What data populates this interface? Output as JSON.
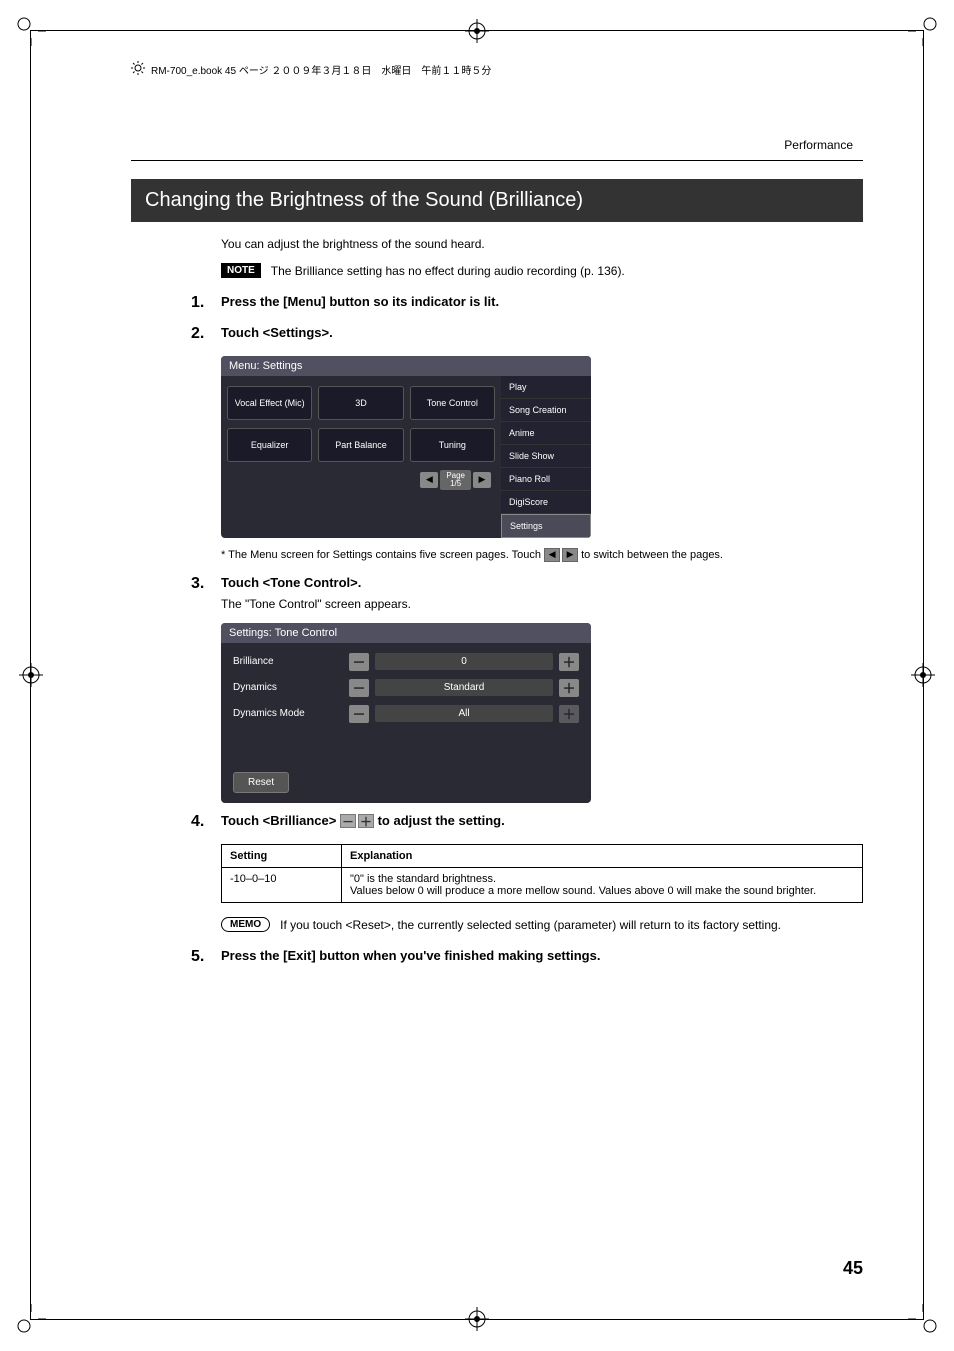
{
  "book_meta": "RM-700_e.book 45 ページ ２００９年３月１８日　水曜日　午前１１時５分",
  "running_head": "Performance",
  "section_title": "Changing the Brightness of the Sound (Brilliance)",
  "intro_text": "You can adjust the brightness of the sound heard.",
  "note_badge": "NOTE",
  "note_text": "The Brilliance setting has no effect during audio recording (p. 136).",
  "step1": {
    "num": "1.",
    "heading": "Press the [Menu] button so its indicator is lit."
  },
  "step2": {
    "num": "2.",
    "heading": "Touch <Settings>."
  },
  "menu_screen": {
    "title": "Menu: Settings",
    "grid": [
      [
        "Vocal Effect (Mic)",
        "3D",
        "Tone Control"
      ],
      [
        "Equalizer",
        "Part Balance",
        "Tuning"
      ]
    ],
    "pager": {
      "label_top": "Page",
      "label_bot": "1/5",
      "prev": "◀",
      "next": "▶"
    },
    "side": [
      "Play",
      "Song Creation",
      "Anime",
      "Slide Show",
      "Piano Roll",
      "DigiScore",
      "Settings"
    ]
  },
  "menu_footnote_prefix": "*  The Menu screen for Settings contains five screen pages. Touch ",
  "menu_footnote_suffix": " to switch between the pages.",
  "arrow_left": "◀",
  "arrow_right": "▶",
  "step3": {
    "num": "3.",
    "heading": "Touch <Tone Control>.",
    "sub": "The \"Tone Control\" screen appears."
  },
  "tone_screen": {
    "title": "Settings: Tone Control",
    "rows": [
      {
        "label": "Brilliance",
        "value": "0",
        "plus_enabled": true
      },
      {
        "label": "Dynamics",
        "value": "Standard",
        "plus_enabled": true
      },
      {
        "label": "Dynamics Mode",
        "value": "All",
        "plus_enabled": false
      }
    ],
    "minus": "－",
    "plus": "＋",
    "reset": "Reset"
  },
  "step4": {
    "num": "4.",
    "heading_prefix": "Touch <Brilliance> ",
    "heading_suffix": " to adjust the setting.",
    "minus": "－",
    "plus": "＋"
  },
  "table": {
    "h1": "Setting",
    "h2": "Explanation",
    "row_setting": "-10–0–10",
    "row_exp_1": "\"0\" is the standard brightness.",
    "row_exp_2": "Values below 0 will produce a more mellow sound. Values above 0 will make the sound brighter."
  },
  "memo_badge": "MEMO",
  "memo_text": "If you touch <Reset>, the currently selected setting (parameter) will return to its factory setting.",
  "step5": {
    "num": "5.",
    "heading": "Press the [Exit] button when you've finished making settings."
  },
  "page_number": "45"
}
